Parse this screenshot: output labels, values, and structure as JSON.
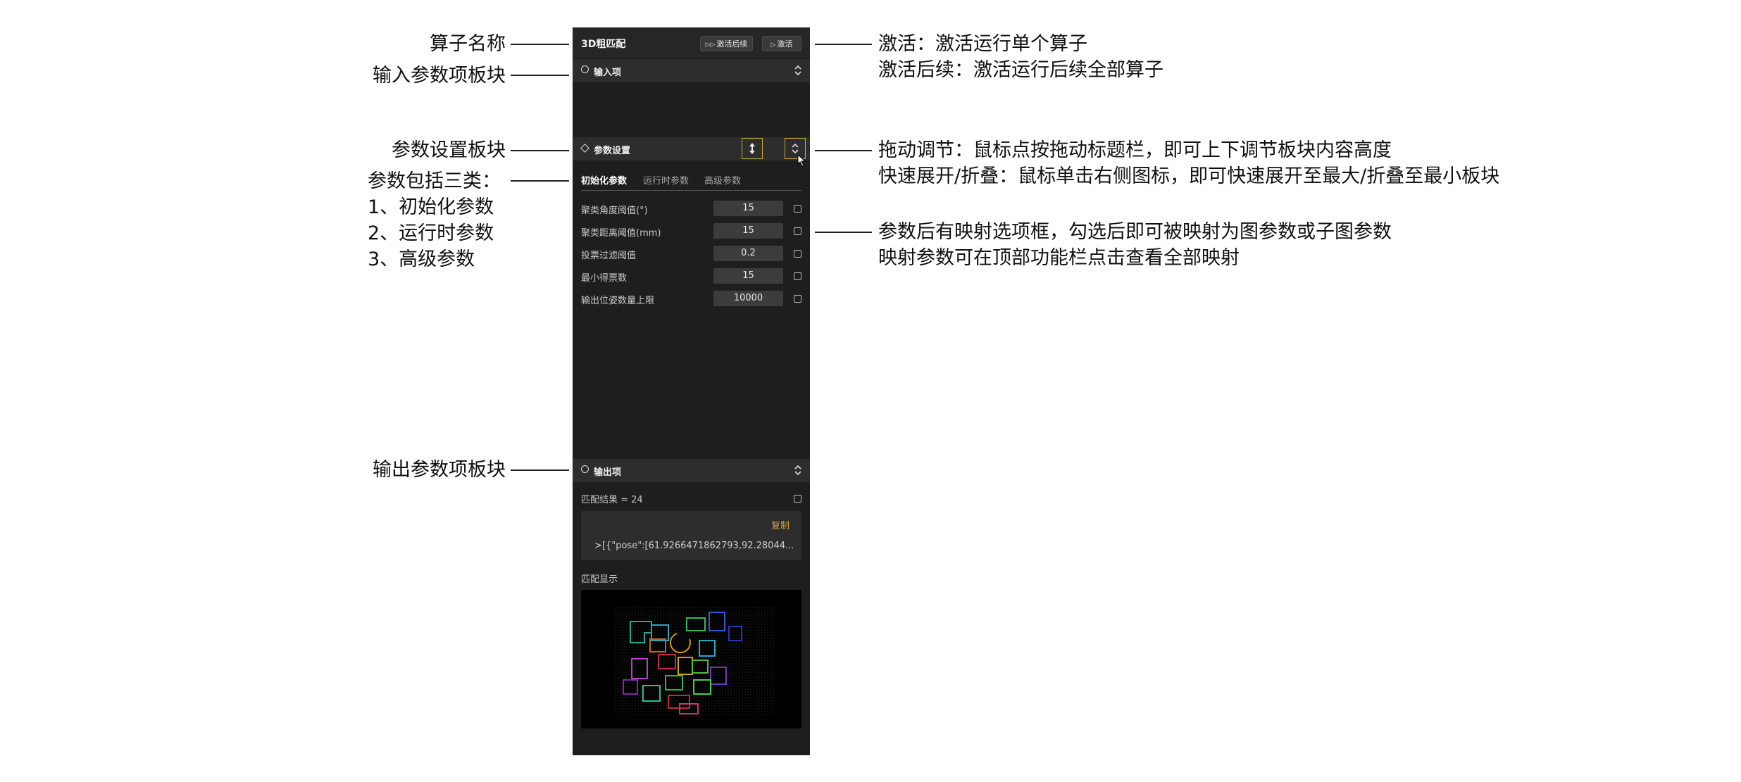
{
  "annotations": {
    "operator_name": "算子名称",
    "input_block": "输入参数项板块",
    "param_block": "参数设置板块",
    "param_types": [
      "参数包括三类：",
      "1、初始化参数",
      "2、运行时参数",
      "3、高级参数"
    ],
    "output_block": "输出参数项板块",
    "activate": [
      "激活：激活运行单个算子",
      "激活后续：激活运行后续全部算子"
    ],
    "drag": [
      "拖动调节：鼠标点按拖动标题栏，即可上下调节板块内容高度",
      "快速展开/折叠：鼠标单击右侧图标，即可快速展开至最大/折叠至最小板块"
    ],
    "mapping": [
      "参数后有映射选项框，勾选后即可被映射为图参数或子图参数",
      "映射参数可在顶部功能栏点击查看全部映射"
    ]
  },
  "panel": {
    "title": "3D粗匹配",
    "btn_activate_continue": "激活后续",
    "btn_activate": "激活",
    "input_section": "输入项",
    "param_section": "参数设置",
    "tabs": [
      "初始化参数",
      "运行时参数",
      "高级参数"
    ],
    "params": [
      {
        "label": "聚类角度阈值(°)",
        "value": "15"
      },
      {
        "label": "聚类距离阈值(mm)",
        "value": "15"
      },
      {
        "label": "投票过滤阈值",
        "value": "0.2"
      },
      {
        "label": "最小得票数",
        "value": "15"
      },
      {
        "label": "输出位姿数量上限",
        "value": "10000"
      }
    ],
    "output_section": "输出项",
    "match_result": "匹配结果 = 24",
    "copy": "复制",
    "json_preview": ">[{\"pose\":[61.9266471862793,92.28044...",
    "display_label": "匹配显示"
  },
  "colors": {
    "panel_bg": "#1e1e1e",
    "header_bg": "#2d2d2d",
    "highlight": "#c8a93a",
    "copy_text": "#d4a63a"
  }
}
